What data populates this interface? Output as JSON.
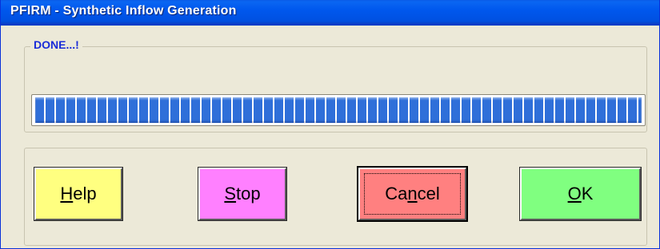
{
  "window": {
    "title": "PFIRM - Synthetic Inflow Generation"
  },
  "status": {
    "label": "DONE...!",
    "progress_fraction": 1.0
  },
  "buttons": {
    "help": {
      "mnemonic": "H",
      "rest": "elp"
    },
    "stop": {
      "mnemonic": "S",
      "rest": "top"
    },
    "cancel": {
      "before": "Ca",
      "mnemonic": "n",
      "rest": "cel"
    },
    "ok": {
      "mnemonic": "O",
      "rest": "K"
    }
  },
  "colors": {
    "title_bar": "#0058ee",
    "status_label": "#1a2cd8",
    "progress_fill": "#2f6fd9",
    "help_button": "#ffff80",
    "stop_button": "#ff80ff",
    "cancel_button": "#ff8080",
    "ok_button": "#80ff80",
    "dialog_background": "#ece9d8"
  }
}
